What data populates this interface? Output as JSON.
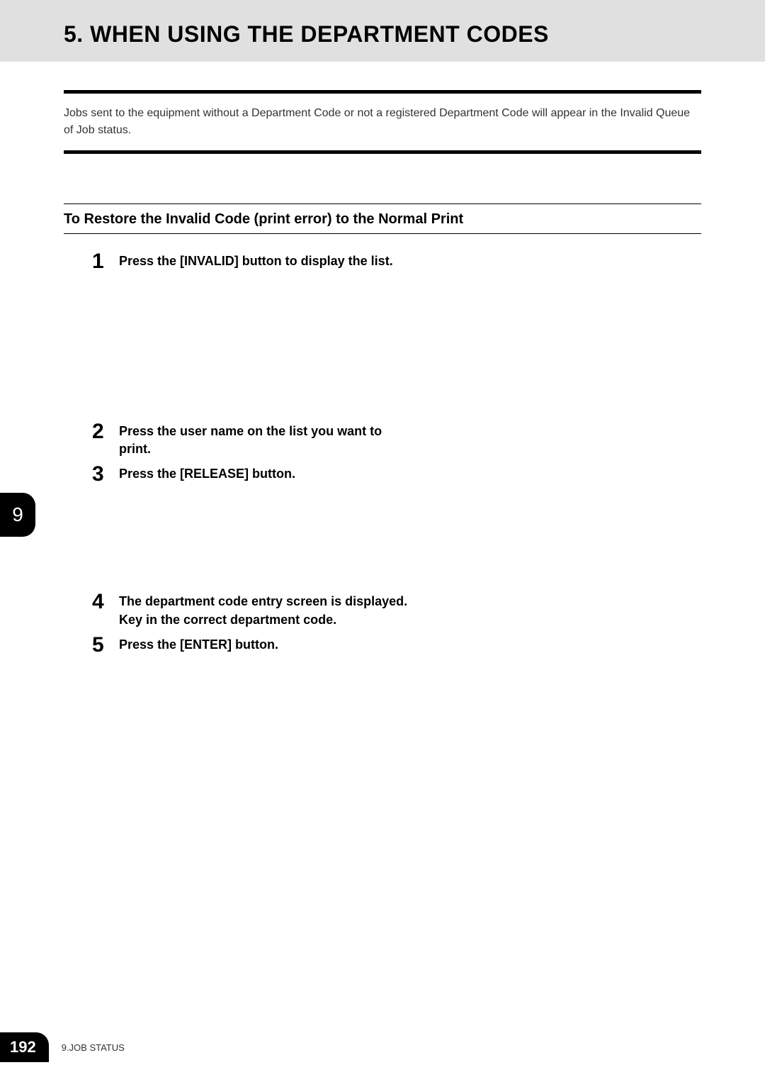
{
  "header": {
    "title": "5. WHEN USING THE DEPARTMENT CODES"
  },
  "intro": "Jobs sent to the equipment without a Department Code or not a registered Department Code will appear in the Invalid Queue of Job status.",
  "section": {
    "heading": "To Restore the Invalid Code (print error) to the Normal Print"
  },
  "steps": [
    {
      "num": "1",
      "text": "Press the [INVALID] button to display the list."
    },
    {
      "num": "2",
      "text": "Press the user name on the list you want to print."
    },
    {
      "num": "3",
      "text": "Press the [RELEASE] button."
    },
    {
      "num": "4",
      "text": "The department code entry screen is displayed. Key in the correct department code."
    },
    {
      "num": "5",
      "text": "Press the [ENTER] button."
    }
  ],
  "chapter_tab": "9",
  "footer": {
    "page": "192",
    "label": "9.JOB STATUS"
  }
}
